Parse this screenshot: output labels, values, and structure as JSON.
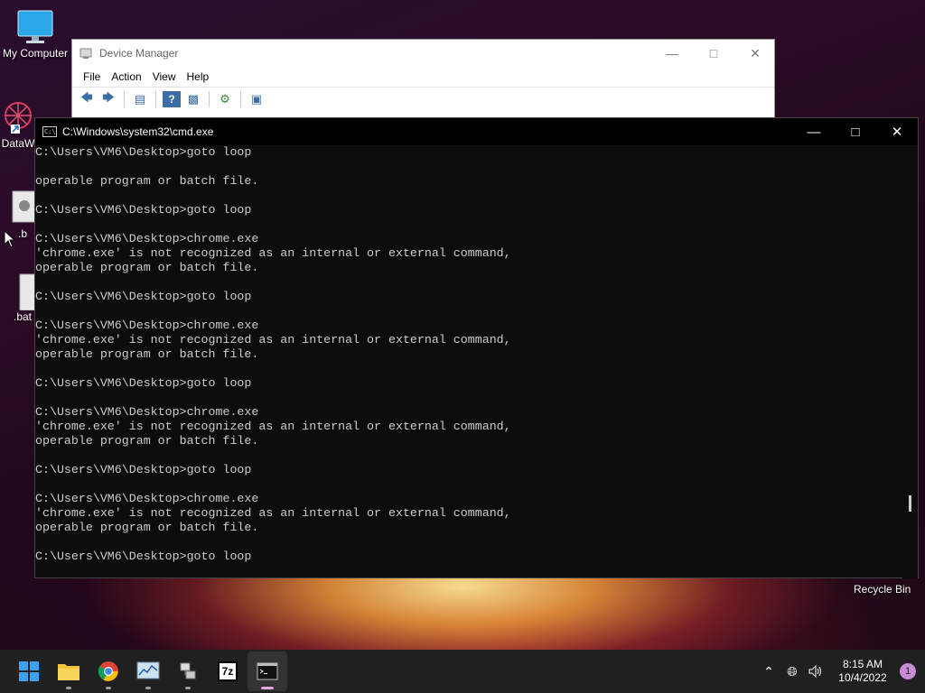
{
  "desktop": {
    "icons": [
      {
        "label": "My Computer"
      },
      {
        "label": "DataW"
      },
      {
        "label": ".b"
      },
      {
        "label": ".bat"
      }
    ],
    "recycle_bin_label": "Recycle Bin"
  },
  "device_manager": {
    "title": "Device Manager",
    "menu": [
      "File",
      "Action",
      "View",
      "Help"
    ]
  },
  "cmd": {
    "title": "C:\\Windows\\system32\\cmd.exe",
    "lines": [
      "C:\\Users\\VM6\\Desktop>goto loop",
      "",
      "operable program or batch file.",
      "",
      "C:\\Users\\VM6\\Desktop>goto loop",
      "",
      "C:\\Users\\VM6\\Desktop>chrome.exe",
      "'chrome.exe' is not recognized as an internal or external command,",
      "operable program or batch file.",
      "",
      "C:\\Users\\VM6\\Desktop>goto loop",
      "",
      "C:\\Users\\VM6\\Desktop>chrome.exe",
      "'chrome.exe' is not recognized as an internal or external command,",
      "operable program or batch file.",
      "",
      "C:\\Users\\VM6\\Desktop>goto loop",
      "",
      "C:\\Users\\VM6\\Desktop>chrome.exe",
      "'chrome.exe' is not recognized as an internal or external command,",
      "operable program or batch file.",
      "",
      "C:\\Users\\VM6\\Desktop>goto loop",
      "",
      "C:\\Users\\VM6\\Desktop>chrome.exe",
      "'chrome.exe' is not recognized as an internal or external command,",
      "operable program or batch file.",
      "",
      "C:\\Users\\VM6\\Desktop>goto loop"
    ]
  },
  "taskbar": {
    "apps": [
      {
        "name": "start",
        "icon": "windows-logo-icon"
      },
      {
        "name": "file-explorer",
        "icon": "folder-icon"
      },
      {
        "name": "chrome",
        "icon": "chrome-icon"
      },
      {
        "name": "performance-monitor",
        "icon": "chart-icon"
      },
      {
        "name": "network-app",
        "icon": "network-icon"
      },
      {
        "name": "7zip",
        "icon": "7zip-icon",
        "text": "7z"
      },
      {
        "name": "cmd",
        "icon": "terminal-icon",
        "active": true
      }
    ],
    "time": "8:15 AM",
    "date": "10/4/2022",
    "notification_count": "1"
  },
  "colors": {
    "console_bg": "#0c0c0c",
    "console_fg": "#cccccc",
    "taskbar_bg": "#202020",
    "accent": "#e3a8e6"
  }
}
